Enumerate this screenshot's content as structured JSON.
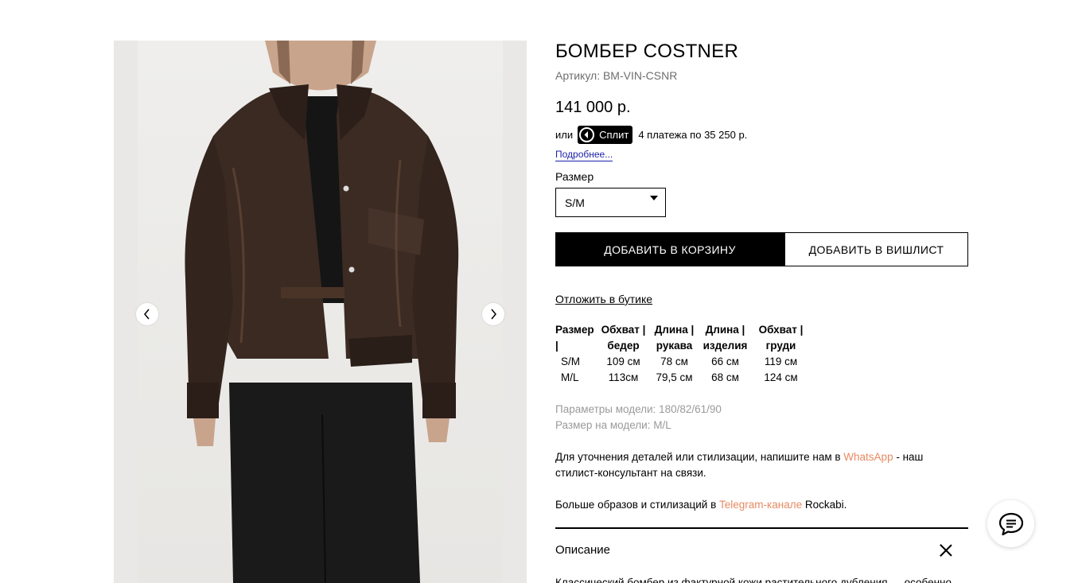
{
  "product": {
    "title": "БОМБЕР COSTNER",
    "sku": "Артикул: BM-VIN-CSNR",
    "price": "141 000 р.",
    "split": {
      "prefix": "или",
      "badge_label": "Сплит",
      "payments_text": "4 платежа по 35 250 р.",
      "more_link": "Подробнее..."
    },
    "size_label": "Размер",
    "size_selected": "S/M",
    "add_to_cart": "ДОБАВИТЬ В КОРЗИНУ",
    "add_to_wishlist": "ДОБАВИТЬ В ВИШЛИСТ",
    "reserve_link": "Отложить в бутике"
  },
  "size_table": {
    "headers": [
      [
        "Размер |",
        ""
      ],
      [
        "Обхват |",
        "бедер"
      ],
      [
        "Длина |",
        "рукава"
      ],
      [
        "Длина |",
        "изделия"
      ],
      [
        "Обхват |",
        "груди"
      ]
    ],
    "rows": [
      [
        "S/M",
        "109 см",
        "78 см",
        "66 см",
        "119 см"
      ],
      [
        "M/L",
        "113см",
        "79,5 см",
        "68 см",
        "124 см"
      ]
    ]
  },
  "model": {
    "params": "Параметры модели: 180/82/61/90",
    "size": "Размер на модели: M/L"
  },
  "contact": {
    "before": "Для уточнения деталей или стилизации, напишите нам в ",
    "link": "WhatsApp",
    "after": " - наш стилист-консультант на связи."
  },
  "more_looks": {
    "before": "Больше образов и стилизаций в ",
    "link": "Telegram-канале",
    "after": " Rockabi."
  },
  "description": {
    "title": "Описание",
    "text": "Классический бомбер из фактурной кожи растительного дубления — особенно"
  },
  "gallery": {
    "prev_icon": "chevron-left-icon",
    "next_icon": "chevron-right-icon"
  },
  "colors": {
    "accent_link": "#e68a62",
    "more_link": "#1d22a8",
    "muted_text": "#9a9a9a"
  }
}
